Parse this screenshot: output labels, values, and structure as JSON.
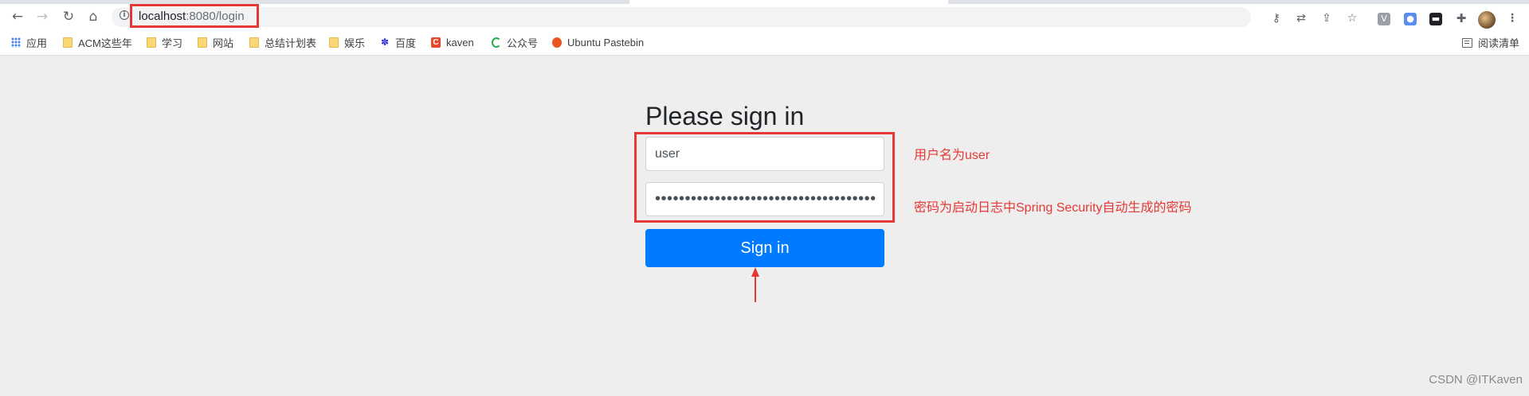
{
  "browser": {
    "url_host": "localhost",
    "url_path": ":8080/login",
    "toolbar_icons": {
      "back": "arrow-left-icon",
      "forward": "arrow-right-icon",
      "reload": "reload-icon",
      "home": "home-icon",
      "site_info": "info-icon",
      "key": "key-icon",
      "translate": "translate-icon",
      "share": "share-icon",
      "bookmark": "star-icon",
      "extensions": "puzzle-icon",
      "menu": "kebab-menu-icon"
    }
  },
  "bookmarks": {
    "items": [
      {
        "label": "应用",
        "icon": "apps-grid-icon"
      },
      {
        "label": "ACM这些年",
        "icon": "folder-icon"
      },
      {
        "label": "学习",
        "icon": "folder-icon"
      },
      {
        "label": "网站",
        "icon": "folder-icon"
      },
      {
        "label": "总结计划表",
        "icon": "folder-icon"
      },
      {
        "label": "娱乐",
        "icon": "folder-icon"
      },
      {
        "label": "百度",
        "icon": "baidu-icon"
      },
      {
        "label": "kaven",
        "icon": "csdn-icon"
      },
      {
        "label": "公众号",
        "icon": "wechat-icon"
      },
      {
        "label": "Ubuntu Pastebin",
        "icon": "ubuntu-icon"
      }
    ],
    "reading_list": "阅读清单"
  },
  "login": {
    "heading": "Please sign in",
    "username_value": "user",
    "password_mask": "•••••••••••••••••••••••••••••••••••••",
    "submit_label": "Sign in"
  },
  "annotations": {
    "username_note": "用户名为user",
    "password_note": "密码为启动日志中Spring Security自动生成的密码",
    "highlight_color": "#e53935"
  },
  "watermark": "CSDN @ITKaven",
  "colors": {
    "primary": "#007bff",
    "page_bg": "#eeeeee"
  }
}
